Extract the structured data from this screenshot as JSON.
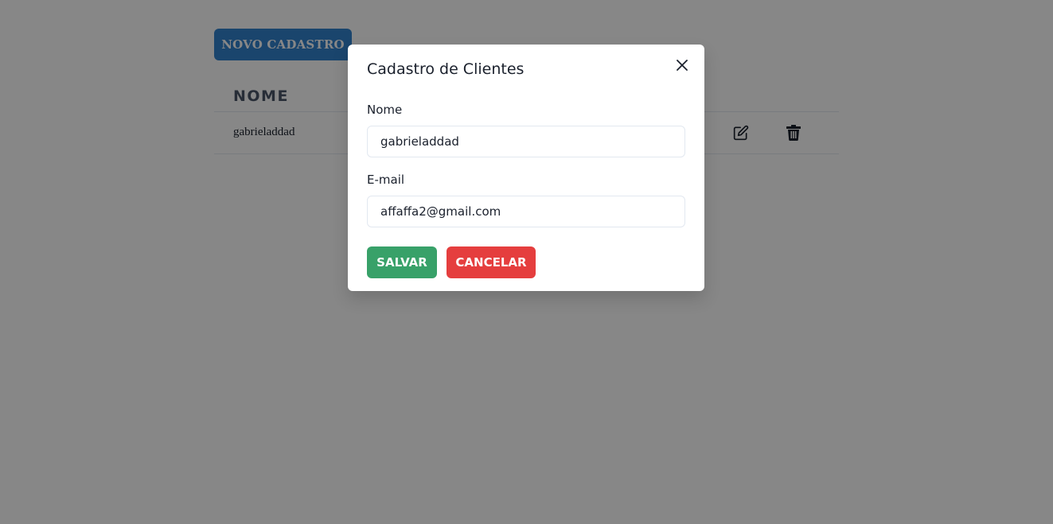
{
  "page": {
    "new_button_label": "NOVO CADASTRO",
    "table": {
      "columns": [
        "NOME"
      ],
      "rows": [
        {
          "nome": "gabrieladdad"
        }
      ]
    },
    "icons": {
      "edit": "edit-icon",
      "delete": "trash-icon"
    }
  },
  "modal": {
    "title": "Cadastro de Clientes",
    "close_icon": "close-icon",
    "fields": {
      "nome": {
        "label": "Nome",
        "value": "gabrieladdad"
      },
      "email": {
        "label": "E-mail",
        "value": "affaffa2@gmail.com"
      }
    },
    "buttons": {
      "save": "SALVAR",
      "cancel": "CANCELAR"
    }
  },
  "colors": {
    "primary": "#3182ce",
    "save": "#38a169",
    "cancel": "#e53e3e",
    "overlay": "rgba(0,0,0,0.47)"
  }
}
